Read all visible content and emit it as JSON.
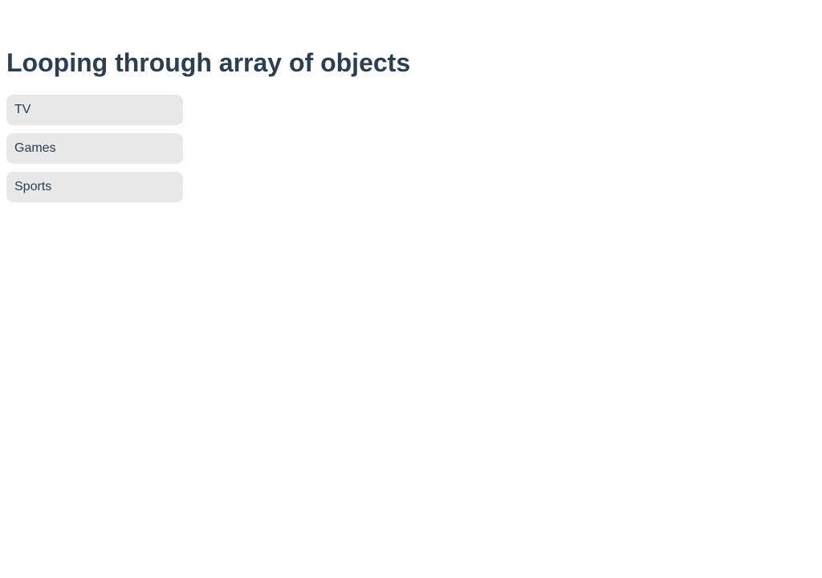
{
  "main": {
    "title": "Looping through array of objects",
    "items": [
      {
        "label": "TV"
      },
      {
        "label": "Games"
      },
      {
        "label": "Sports"
      }
    ]
  },
  "colors": {
    "text": "#2c3e50",
    "item_background": "#e8e8e8",
    "page_background": "#ffffff"
  }
}
